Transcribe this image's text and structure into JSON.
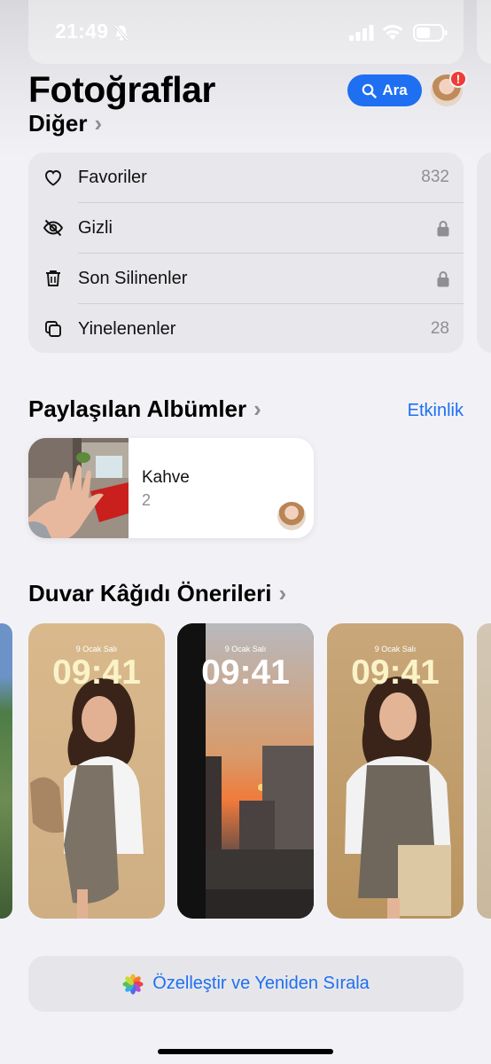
{
  "status_bar": {
    "time": "21:49"
  },
  "header": {
    "title": "Fotoğraflar",
    "search_label": "Ara",
    "avatar_badge": "!"
  },
  "other": {
    "heading": "Diğer",
    "items": [
      {
        "label": "Favoriler",
        "count": "832"
      },
      {
        "label": "Gizli",
        "locked": true
      },
      {
        "label": "Son Silinenler",
        "locked": true
      },
      {
        "label": "Yinelenenler",
        "count": "28"
      }
    ]
  },
  "shared_albums": {
    "heading": "Paylaşılan Albümler",
    "activity_label": "Etkinlik",
    "albums": [
      {
        "name": "Kahve",
        "count": "2"
      }
    ]
  },
  "wallpapers": {
    "heading": "Duvar Kâğıdı Önerileri",
    "items": [
      {
        "date": "9 Ocak Salı",
        "time": "09:41"
      },
      {
        "date": "9 Ocak Salı",
        "time": "09:41"
      },
      {
        "date": "9 Ocak Salı",
        "time": "09:41"
      }
    ]
  },
  "footer": {
    "customize_label": "Özelleştir ve Yeniden Sırala"
  },
  "colors": {
    "accent": "#1e6ff2",
    "badge": "#ef3b36"
  }
}
